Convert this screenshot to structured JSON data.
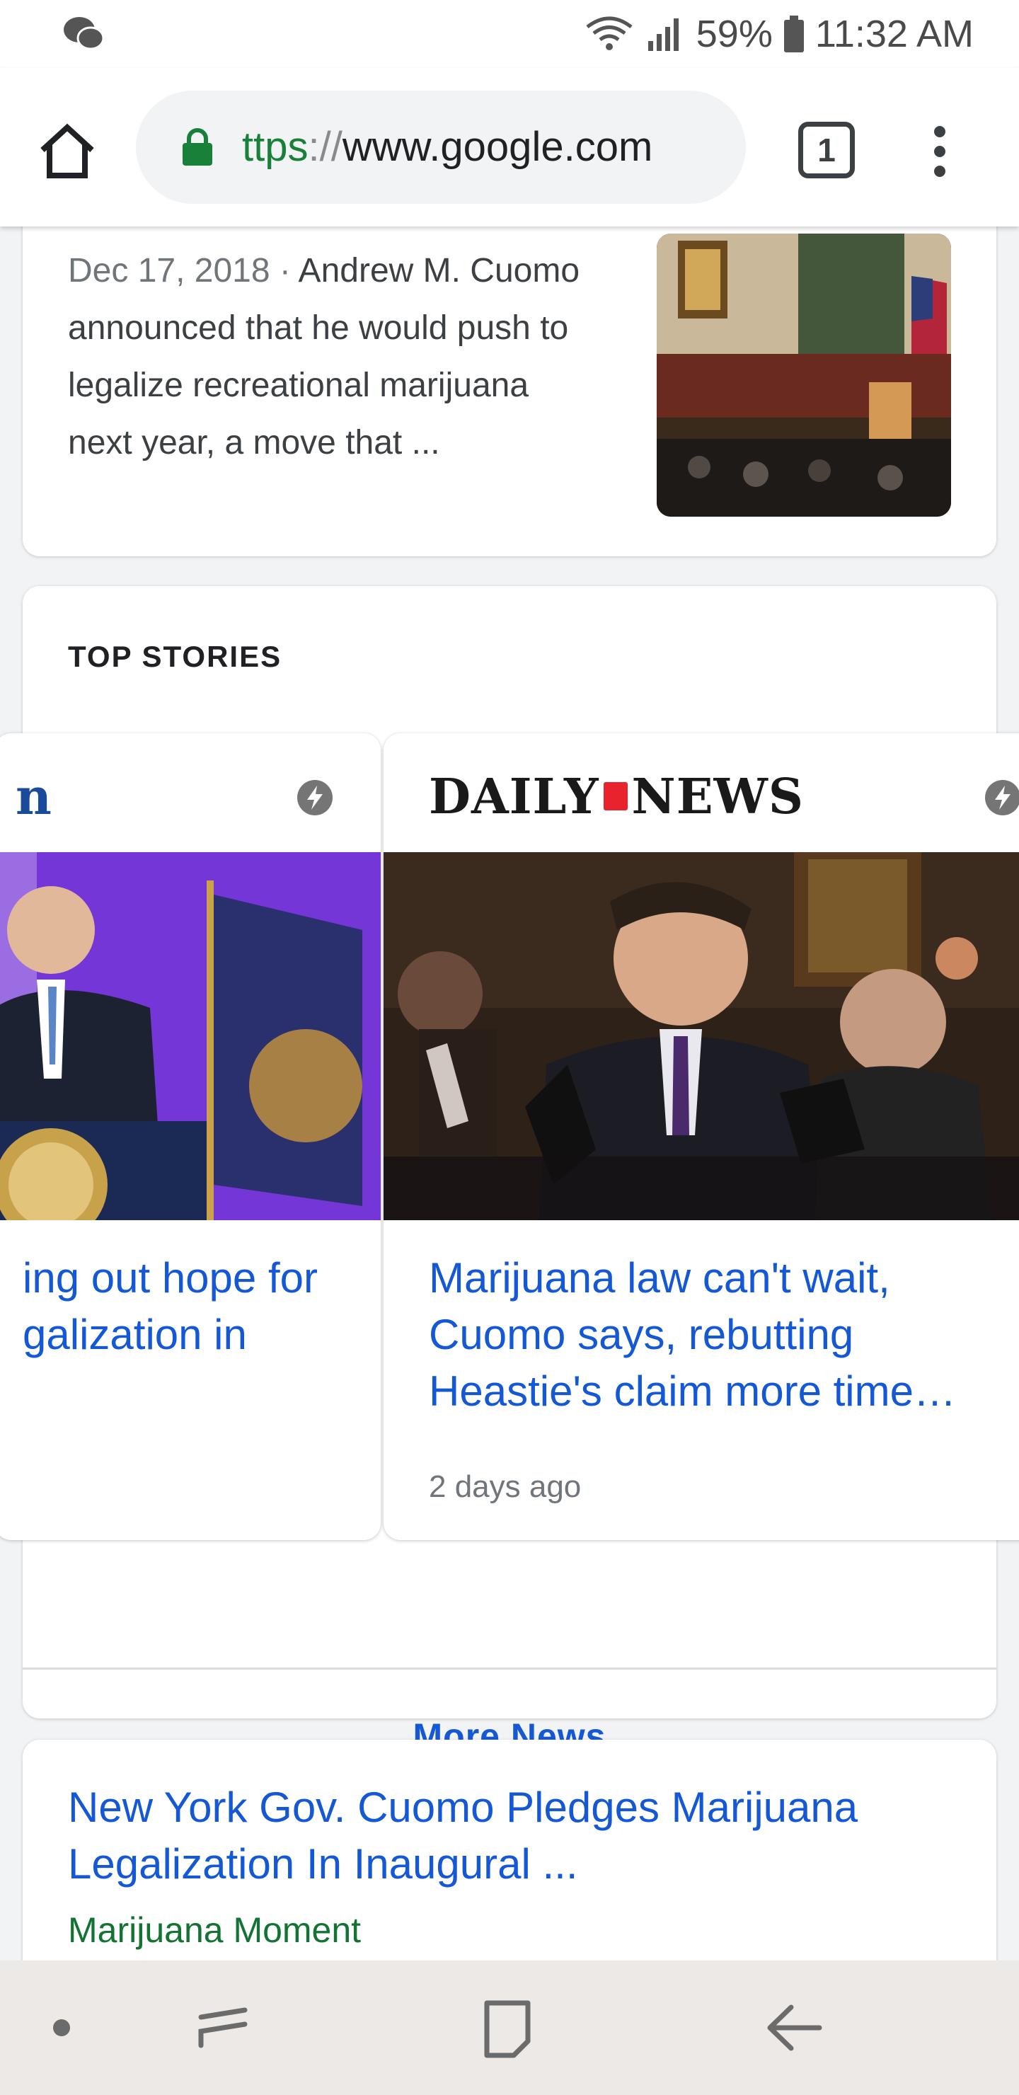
{
  "status_bar": {
    "battery": "59%",
    "time": "11:32 AM",
    "icons": [
      "wechat-icon",
      "wifi-icon",
      "signal-icon",
      "battery-icon"
    ]
  },
  "browser": {
    "url_scheme": "ttps",
    "url_sep": "://",
    "url_host": "www.google.com",
    "tab_count": "1",
    "icons": [
      "home-icon",
      "lock-icon",
      "tabs-icon",
      "overflow-menu-icon"
    ]
  },
  "result_snippet": {
    "date": "Dec 17, 2018 · ",
    "text": "Andrew M. Cuomo announced that he would push to legalize recreational marijuana next year, a move that ..."
  },
  "top_stories": {
    "heading": "TOP STORIES",
    "stories": [
      {
        "publisher": "n",
        "title": "ing out hope for galization in",
        "time": ""
      },
      {
        "publisher": "DAILY NEWS",
        "publisher_part1": "DAILY",
        "publisher_part2": "NEWS",
        "title": "Marijuana law can't wait, Cuomo says, rebutting Heastie's claim more time…",
        "time": "2 days ago"
      }
    ],
    "more_label": "More News"
  },
  "next_result": {
    "title": "New York Gov. Cuomo Pledges Marijuana Legalization In Inaugural ...",
    "source": "Marijuana Moment"
  },
  "navbar": {
    "icons": [
      "dot-icon",
      "recents-icon",
      "home-square-icon",
      "back-icon"
    ]
  },
  "colors": {
    "link": "#1558d6",
    "url_green": "#188038",
    "source_green": "#137333"
  }
}
